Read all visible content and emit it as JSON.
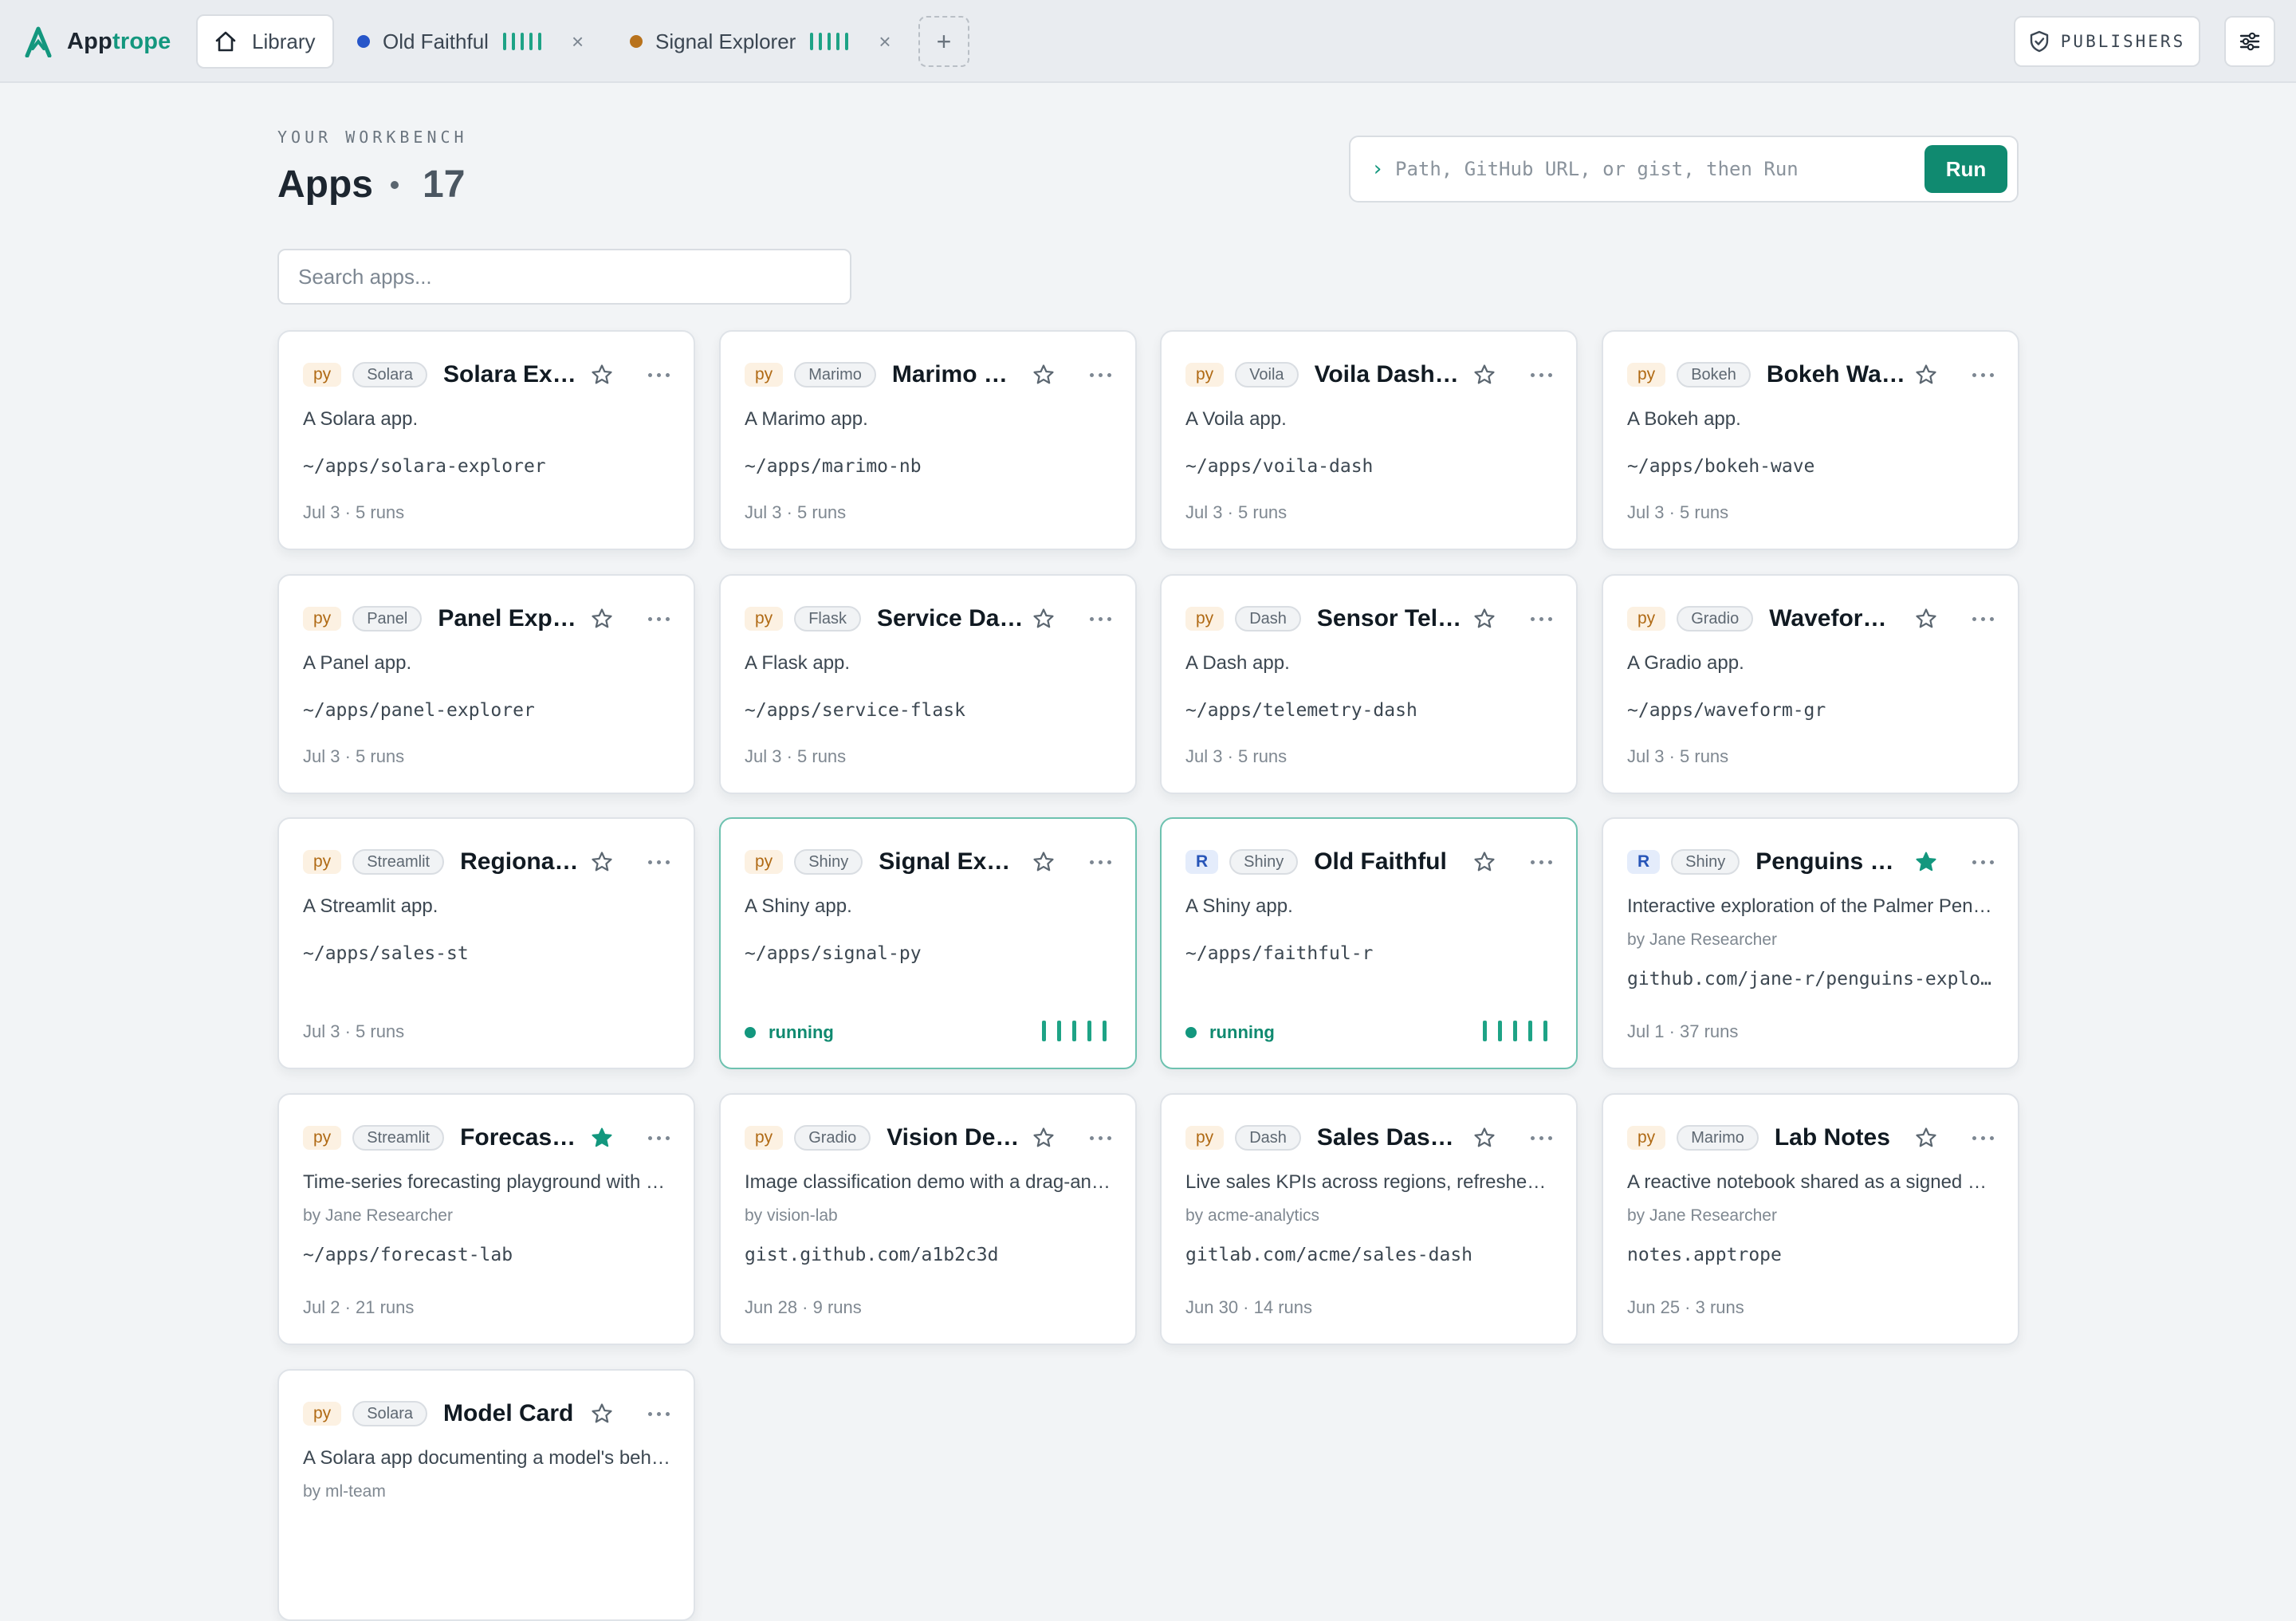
{
  "brand": {
    "part1": "App",
    "part2": "trope"
  },
  "tabs": [
    {
      "label": "Library",
      "icon": "home-icon",
      "active": true
    },
    {
      "label": "Old Faithful",
      "dot_color": "#2756c9",
      "closable": true
    },
    {
      "label": "Signal Explorer",
      "dot_color": "#b8721c",
      "closable": true
    }
  ],
  "tab_close_glyph": "×",
  "new_tab_glyph": "+",
  "publishers_label": "PUBLISHERS",
  "eyebrow": "YOUR WORKBENCH",
  "title": "Apps",
  "app_count": "17",
  "run_prompt": "›",
  "run_placeholder": "Path, GitHub URL, or gist, then Run",
  "run_button": "Run",
  "search_placeholder": "Search apps...",
  "colors": {
    "accent": "#108a70",
    "running": "#13977e",
    "star_filled": "#13977e"
  },
  "apps": [
    {
      "lang": "py",
      "framework": "Solara",
      "name": "Solara Explorer",
      "desc": "A Solara app.",
      "path": "~/apps/solara-explorer",
      "meta": "Jul 3 · 5 runs"
    },
    {
      "lang": "py",
      "framework": "Marimo",
      "name": "Marimo Notebook",
      "desc": "A Marimo app.",
      "path": "~/apps/marimo-nb",
      "meta": "Jul 3 · 5 runs"
    },
    {
      "lang": "py",
      "framework": "Voila",
      "name": "Voila Dashboard",
      "desc": "A Voila app.",
      "path": "~/apps/voila-dash",
      "meta": "Jul 3 · 5 runs"
    },
    {
      "lang": "py",
      "framework": "Bokeh",
      "name": "Bokeh Wave",
      "desc": "A Bokeh app.",
      "path": "~/apps/bokeh-wave",
      "meta": "Jul 3 · 5 runs"
    },
    {
      "lang": "py",
      "framework": "Panel",
      "name": "Panel Explorer",
      "desc": "A Panel app.",
      "path": "~/apps/panel-explorer",
      "meta": "Jul 3 · 5 runs"
    },
    {
      "lang": "py",
      "framework": "Flask",
      "name": "Service Dashboard",
      "desc": "A Flask app.",
      "path": "~/apps/service-flask",
      "meta": "Jul 3 · 5 runs"
    },
    {
      "lang": "py",
      "framework": "Dash",
      "name": "Sensor Telemetry",
      "desc": "A Dash app.",
      "path": "~/apps/telemetry-dash",
      "meta": "Jul 3 · 5 runs"
    },
    {
      "lang": "py",
      "framework": "Gradio",
      "name": "Waveform Studio",
      "desc": "A Gradio app.",
      "path": "~/apps/waveform-gr",
      "meta": "Jul 3 · 5 runs"
    },
    {
      "lang": "py",
      "framework": "Streamlit",
      "name": "Regional Sales",
      "desc": "A Streamlit app.",
      "path": "~/apps/sales-st",
      "meta": "Jul 3 · 5 runs"
    },
    {
      "lang": "py",
      "framework": "Shiny",
      "name": "Signal Explorer",
      "desc": "A Shiny app.",
      "path": "~/apps/signal-py",
      "status": "running"
    },
    {
      "lang": "R",
      "framework": "Shiny",
      "name": "Old Faithful",
      "desc": "A Shiny app.",
      "path": "~/apps/faithful-r",
      "status": "running"
    },
    {
      "lang": "R",
      "framework": "Shiny",
      "name": "Penguins Explorer",
      "starred": true,
      "desc": "Interactive exploration of the Palmer Penguins dataset",
      "author": "by Jane Researcher",
      "path": "github.com/jane-r/penguins-explorer",
      "meta": "Jul 1 · 37 runs"
    },
    {
      "lang": "py",
      "framework": "Streamlit",
      "name": "Forecast Lab",
      "starred": true,
      "desc": "Time-series forecasting playground with adjustable models",
      "author": "by Jane Researcher",
      "path": "~/apps/forecast-lab",
      "meta": "Jul 2 · 21 runs"
    },
    {
      "lang": "py",
      "framework": "Gradio",
      "name": "Vision Demo",
      "desc": "Image classification demo with a drag-and-drop uploader",
      "author": "by vision-lab",
      "path": "gist.github.com/a1b2c3d",
      "meta": "Jun 28 · 9 runs"
    },
    {
      "lang": "py",
      "framework": "Dash",
      "name": "Sales Dashboard",
      "desc": "Live sales KPIs across regions, refreshed hourly",
      "author": "by acme-analytics",
      "path": "gitlab.com/acme/sales-dash",
      "meta": "Jun 30 · 14 runs"
    },
    {
      "lang": "py",
      "framework": "Marimo",
      "name": "Lab Notes",
      "desc": "A reactive notebook shared as a signed bundle",
      "author": "by Jane Researcher",
      "path": "notes.apptrope",
      "meta": "Jun 25 · 3 runs"
    },
    {
      "lang": "py",
      "framework": "Solara",
      "name": "Model Card",
      "desc": "A Solara app documenting a model's behavior",
      "author": "by ml-team",
      "path": "",
      "meta": ""
    }
  ]
}
